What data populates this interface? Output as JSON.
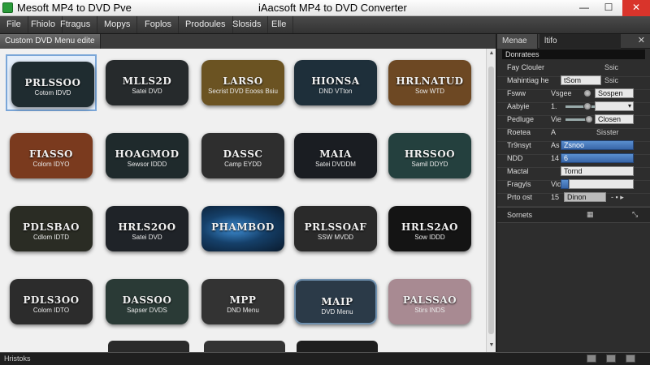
{
  "window": {
    "left_title": "Mesoft MP4 to DVD Pve",
    "center_title": "iAacsoft MP4 to DVD Converter",
    "minimize": "—",
    "maximize": "☐",
    "close": "✕"
  },
  "menu": [
    "File",
    "Fhiolo",
    "Ftragus",
    "Mopys",
    "Foplos",
    "Prodoules",
    "Slosids",
    "Elle"
  ],
  "left_tab": "Custom DVD Menu edite",
  "thumbnails": [
    {
      "t1": "PRLSSOO",
      "t2": "Cotom IDVD",
      "color": "#1f2c30"
    },
    {
      "t1": "MLLS2D",
      "t2": "Satei DVD",
      "color": "#262a2c"
    },
    {
      "t1": "LARSO",
      "t2": "Secrist DVD Eooss Bsiu",
      "color": "#6b5322"
    },
    {
      "t1": "HIONSA",
      "t2": "DND VTton",
      "color": "#1e2f3a"
    },
    {
      "t1": "HRLNATUD",
      "t2": "Sow WTD",
      "color": "#6d4823"
    },
    {
      "t1": "FIASSO",
      "t2": "Colom IDYO",
      "color": "#7a3a1e"
    },
    {
      "t1": "HOAGMOD",
      "t2": "Sewsor IDDD",
      "color": "#1f2a2c"
    },
    {
      "t1": "DASSC",
      "t2": "Camp EYDD",
      "color": "#2e2e2e"
    },
    {
      "t1": "MAIA",
      "t2": "Satei DVDDM",
      "color": "#1a1d22"
    },
    {
      "t1": "HRSSOO",
      "t2": "Samil DDYD",
      "color": "#24403e"
    },
    {
      "t1": "PDLSBAO",
      "t2": "Cdlom IDTD",
      "color": "#2a2c24"
    },
    {
      "t1": "HRLS2OO",
      "t2": "Satei DVD",
      "color": "#1f2328"
    },
    {
      "t1": "PHAMBOD",
      "t2": "",
      "color": "#123a5e"
    },
    {
      "t1": "PRLSSOAF",
      "t2": "SSW MVDD",
      "color": "#2a2a2a"
    },
    {
      "t1": "HRLS2AO",
      "t2": "Sow IDDD",
      "color": "#141414"
    },
    {
      "t1": "PDLS3OO",
      "t2": "Colom IDTO",
      "color": "#2c2c2c"
    },
    {
      "t1": "DASSOO",
      "t2": "Sapser DVDS",
      "color": "#2a3a36"
    },
    {
      "t1": "MPP",
      "t2": "DND Menu",
      "color": "#333333"
    },
    {
      "t1": "MAIP",
      "t2": "DVD Menu",
      "color": "#2b3a48"
    },
    {
      "t1": "PALSSAO",
      "t2": "Stirs INDS",
      "color": "#a88a92"
    }
  ],
  "right_tabs": {
    "tab1": "Menae",
    "tab2": "ltifo",
    "close": "✕"
  },
  "props_header": "Donratees",
  "props": [
    {
      "label": "Fay Clouler",
      "value": "",
      "extra": "Ssic"
    },
    {
      "label": "Mahintiag he",
      "value": "tSom",
      "extra": "Ssic"
    },
    {
      "label": "Fsww",
      "value": "Vsgee",
      "extra": "Sospen"
    },
    {
      "label": "Aabyie",
      "value": "1.",
      "extra": ""
    },
    {
      "label": "Pedluge",
      "value": "Vie",
      "extra": "Closen"
    },
    {
      "label": "Roetea",
      "value": "A",
      "extra": "Sisster"
    },
    {
      "label": "Tr9nsyt",
      "value": "As",
      "extra": "Zsnoo"
    },
    {
      "label": "NDD",
      "value": "14",
      "extra": "6"
    },
    {
      "label": "Mactal",
      "value": "",
      "extra": "Tornd"
    },
    {
      "label": "Fragyls",
      "value": "Vioed",
      "extra": ""
    },
    {
      "label": "Prto ost",
      "value": "15",
      "extra": "Dinon"
    }
  ],
  "section2": "Sornets",
  "status": "Hristoks"
}
